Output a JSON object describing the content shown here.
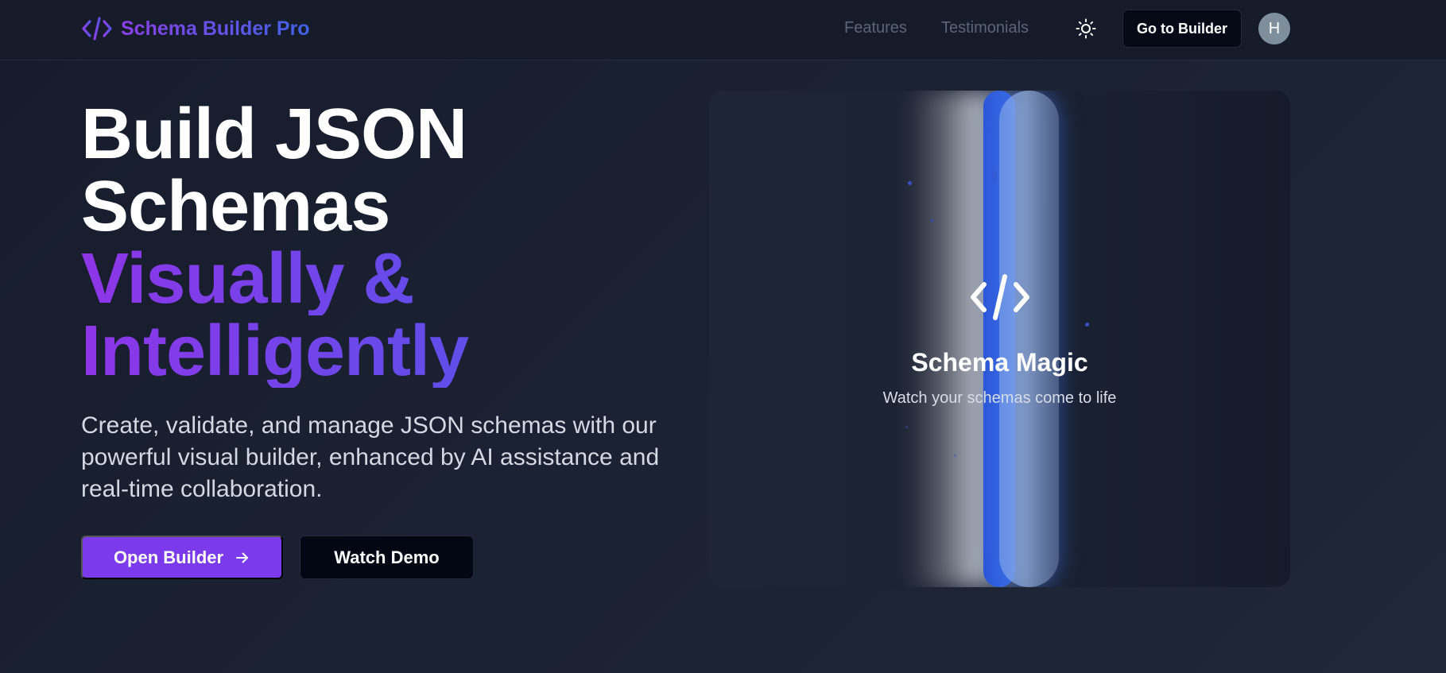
{
  "app": {
    "brand_name": "Schema Builder Pro",
    "brand_icon": "code-brackets-icon"
  },
  "nav": {
    "links": [
      {
        "label": "Features"
      },
      {
        "label": "Testimonials"
      }
    ],
    "theme_toggle_icon": "sun-icon",
    "cta_label": "Go to Builder",
    "avatar_initial": "H"
  },
  "hero": {
    "title_line1": "Build JSON",
    "title_line2": "Schemas",
    "title_accent_line1": "Visually &",
    "title_accent_line2": "Intelligently",
    "subtitle": "Create, validate, and manage JSON schemas with our powerful visual builder, enhanced by AI assistance and real-time collaboration.",
    "primary_button": "Open Builder",
    "primary_button_icon": "arrow-right-icon",
    "secondary_button": "Watch Demo"
  },
  "showcase": {
    "icon": "code-brackets-icon",
    "title": "Schema Magic",
    "subtitle": "Watch your schemas come to life"
  },
  "colors": {
    "accent": "#7c3aed",
    "gradient_start": "#8e35e8",
    "gradient_end": "#4a5ae8",
    "background": "#1b2233"
  }
}
